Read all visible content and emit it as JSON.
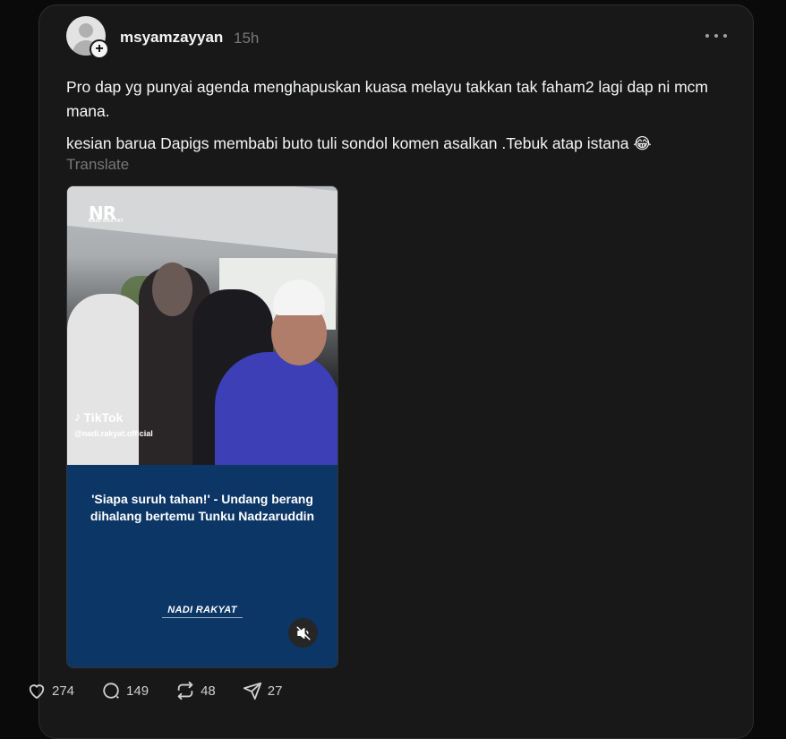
{
  "post": {
    "username": "msyamzayyan",
    "time": "15h",
    "paragraph1": "Pro dap yg punyai agenda menghapuskan kuasa melayu takkan tak faham2 lagi dap ni mcm mana.",
    "paragraph2": "kesian barua Dapigs membabi buto tuli sondol komen asalkan .Tebuk atap istana 😂",
    "translate_label": "Translate"
  },
  "media": {
    "logo_text": "NR",
    "logo_sub": "NADI RAKYAT",
    "tiktok_label": "TikTok",
    "tiktok_handle": "@nadi.rakyat.official",
    "headline": "'Siapa suruh tahan!' - Undang berang dihalang bertemu Tunku Nadzaruddin",
    "brand": "NADI RAKYAT"
  },
  "actions": {
    "likes": "274",
    "comments": "149",
    "reposts": "48",
    "shares": "27"
  },
  "icons": {
    "avatar": "avatar-placeholder-icon",
    "follow": "plus-icon",
    "more": "more-horizontal-icon",
    "mute": "muted-speaker-icon",
    "like": "heart-icon",
    "comment": "comment-bubble-icon",
    "repost": "repost-icon",
    "share": "send-icon"
  },
  "colors": {
    "background": "#0a0a0a",
    "card": "#181818",
    "text_primary": "#f3f5f7",
    "text_secondary": "#777777",
    "media_panel": "#0c3666"
  }
}
